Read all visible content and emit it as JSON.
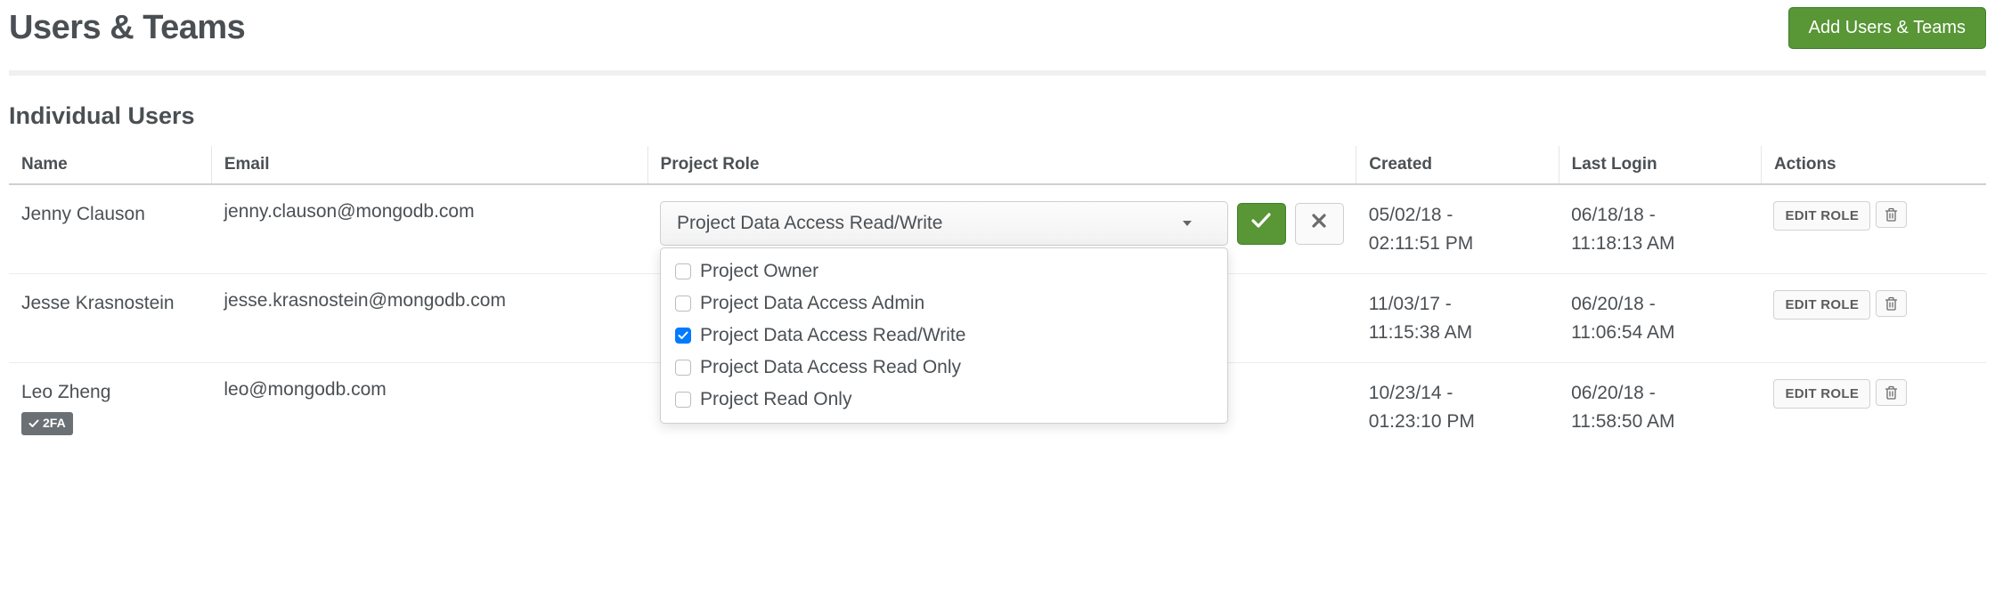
{
  "header": {
    "title": "Users & Teams",
    "add_button": "Add Users & Teams"
  },
  "section_title": "Individual Users",
  "columns": {
    "name": "Name",
    "email": "Email",
    "role": "Project Role",
    "created": "Created",
    "last_login": "Last Login",
    "actions": "Actions"
  },
  "edit_role_label": "EDIT ROLE",
  "role_selected": "Project Data Access Read/Write",
  "role_options": [
    {
      "label": "Project Owner",
      "checked": false
    },
    {
      "label": "Project Data Access Admin",
      "checked": false
    },
    {
      "label": "Project Data Access Read/Write",
      "checked": true
    },
    {
      "label": "Project Data Access Read Only",
      "checked": false
    },
    {
      "label": "Project Read Only",
      "checked": false
    }
  ],
  "twofa_label": "2FA",
  "rows": [
    {
      "name": "Jenny Clauson",
      "email": "jenny.clauson@mongodb.com",
      "created_l1": "05/02/18 -",
      "created_l2": "02:11:51 PM",
      "last_l1": "06/18/18 -",
      "last_l2": "11:18:13 AM",
      "twofa": false,
      "editing": true
    },
    {
      "name": "Jesse Krasnostein",
      "email": "jesse.krasnostein@mongodb.com",
      "created_l1": "11/03/17 -",
      "created_l2": "11:15:38 AM",
      "last_l1": "06/20/18 -",
      "last_l2": "11:06:54 AM",
      "twofa": false,
      "editing": false
    },
    {
      "name": "Leo Zheng",
      "email": "leo@mongodb.com",
      "created_l1": "10/23/14 -",
      "created_l2": "01:23:10 PM",
      "last_l1": "06/20/18 -",
      "last_l2": "11:58:50 AM",
      "twofa": true,
      "editing": false
    }
  ]
}
